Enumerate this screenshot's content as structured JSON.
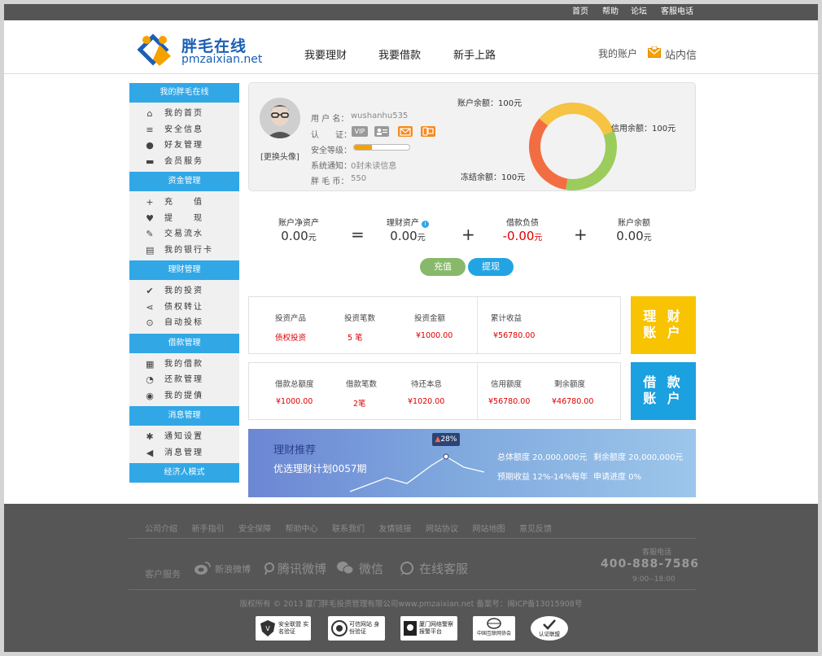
{
  "topbar": {
    "links": [
      "首页",
      "帮助",
      "论坛",
      "客服电话"
    ]
  },
  "header": {
    "logo_name": "胖毛在线",
    "logo_url": "pmzaixian.net",
    "nav": [
      "我要理财",
      "我要借款",
      "新手上路"
    ],
    "account": "我的账户",
    "messages": "站内信"
  },
  "sidebar": {
    "sections": [
      {
        "title": "我的胖毛在线",
        "items": [
          {
            "label": "我的首页",
            "icon": "home-icon"
          },
          {
            "label": "安全信息",
            "icon": "list-icon"
          },
          {
            "label": "好友管理",
            "icon": "user-icon"
          },
          {
            "label": "会员服务",
            "icon": "chat-icon"
          }
        ]
      },
      {
        "title": "资金管理",
        "items": [
          {
            "label": "充　　值",
            "icon": "plus-icon"
          },
          {
            "label": "提　　现",
            "icon": "heart-icon"
          },
          {
            "label": "交易流水",
            "icon": "edit-icon"
          },
          {
            "label": "我的银行卡",
            "icon": "bank-icon"
          }
        ]
      },
      {
        "title": "理财管理",
        "items": [
          {
            "label": "我的投资",
            "icon": "check-circle-icon"
          },
          {
            "label": "债权转让",
            "icon": "share-icon"
          },
          {
            "label": "自动投标",
            "icon": "pin-icon"
          }
        ]
      },
      {
        "title": "借款管理",
        "items": [
          {
            "label": "我的借款",
            "icon": "calendar-icon"
          },
          {
            "label": "还款管理",
            "icon": "clock-icon"
          },
          {
            "label": "我的提債",
            "icon": "eye-icon"
          }
        ]
      },
      {
        "title": "消息管理",
        "items": [
          {
            "label": "通知设置",
            "icon": "gear-icon"
          },
          {
            "label": "消息管理",
            "icon": "speaker-icon"
          }
        ]
      },
      {
        "title": "经济人模式",
        "items": []
      }
    ]
  },
  "profile": {
    "avatar_link": "[更换头像]",
    "username_label": "用 户 名：",
    "username": "wushanhu535",
    "cert_label": "认　　证：",
    "vip": "VIP",
    "security_label": "安全等级：",
    "security_level": 0.33,
    "notice_label": "系统通知：",
    "notice": "0封未读信息",
    "coins_label": "胖 毛 币：",
    "coins": "550"
  },
  "balances": {
    "account": "账户余额：100元",
    "credit": "信用余额：100元",
    "frozen": "冻结余额：100元",
    "colors": {
      "account": "#f6c342",
      "credit": "#9ccc5c",
      "frozen": "#f36d43"
    }
  },
  "equation": {
    "net": {
      "label": "账户净资产",
      "value": "0.00",
      "unit": "元"
    },
    "eq": "=",
    "invest": {
      "label": "理财资产",
      "value": "0.00",
      "unit": "元"
    },
    "plus1": "+",
    "debt": {
      "label": "借款负债",
      "value": "-0.00",
      "unit": "元"
    },
    "plus2": "+",
    "balance": {
      "label": "账户余额",
      "value": "0.00",
      "unit": "元"
    },
    "recharge": "充值",
    "withdraw": "提现"
  },
  "invest_panel": {
    "headers": [
      "投资产品",
      "投资笔数",
      "投资金额",
      "累计收益"
    ],
    "values": [
      "债权投资",
      "5 笔",
      "¥1000.00",
      "¥56780.00"
    ],
    "tag": [
      "理 财",
      "账 户"
    ]
  },
  "loan_panel": {
    "headers": [
      "借款总额度",
      "借款笔数",
      "待还本息",
      "信用额度",
      "剩余额度"
    ],
    "values": [
      "¥1000.00",
      "2笔",
      "¥1020.00",
      "¥56780.00",
      "¥46780.00"
    ],
    "tag": [
      "借 款",
      "账 户"
    ]
  },
  "recommend": {
    "title": "理财推荐",
    "name": "优选理财计划0057期",
    "rate": "28",
    "total": "总体额度 20,000,000元",
    "remaining": "剩余额度 20,000,000元",
    "yield": "预期收益 12%-14%每年",
    "progress": "申请进度 0%"
  },
  "footer": {
    "links": [
      "公司介绍",
      "新手指引",
      "安全保障",
      "帮助中心",
      "联系我们",
      "友情链接",
      "网站协议",
      "网站地图",
      "意见反馈"
    ],
    "cs_label": "客户服务",
    "social": [
      "新浪微博",
      "腾讯微博",
      "微信",
      "在线客服"
    ],
    "hotline_label": "客服电话",
    "hotline": "400-888-7586",
    "hours": "9:00--18:00",
    "copyright": "版权所有 © 2013 厦门胖毛投资管理有限公司www.pmzaixian.net 备案号：闽ICP备13015908号",
    "certs": [
      "安全联盟 实名验证",
      "可信网站 身份验证",
      "厦门网络警察报警平台",
      "中国互联网协会",
      "认证联盟"
    ]
  }
}
